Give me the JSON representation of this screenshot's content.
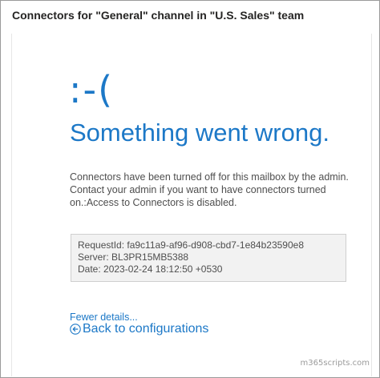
{
  "dialog": {
    "title": "Connectors for \"General\" channel in \"U.S. Sales\" team"
  },
  "error": {
    "face": ":-(",
    "heading": "Something went wrong.",
    "message": "Connectors have been turned off for this mailbox by the admin. Contact your admin if you want to have connectors turned on.:Access to Connectors is disabled.",
    "details": {
      "request_id": "RequestId: fa9c11a9-af96-d908-cbd7-1e84b23590e8",
      "server": "Server: BL3PR15MB5388",
      "date": "Date: 2023-02-24 18:12:50 +0530"
    }
  },
  "links": {
    "fewer_details": "Fewer details...",
    "back": "Back to configurations",
    "back_icon": "arrow-left-circle-icon"
  },
  "watermark": "m365scripts.com",
  "colors": {
    "accent": "#1c78c7",
    "text": "#4e4e4e",
    "title": "#252423",
    "details_bg": "#f2f2f2"
  }
}
